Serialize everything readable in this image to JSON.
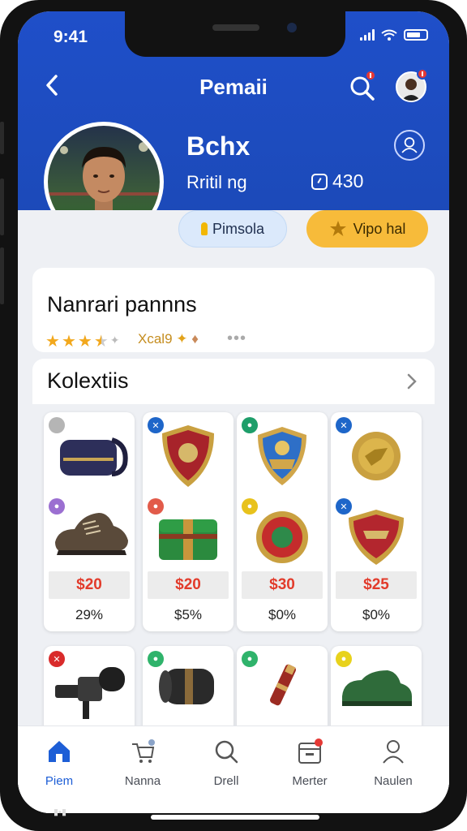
{
  "status_bar": {
    "time": "9:41"
  },
  "header": {
    "title": "Pemaii"
  },
  "profile": {
    "name": "Bchx",
    "subtitle": "Rritil ng",
    "score": "430"
  },
  "actions": {
    "primary_label": "Pimsola",
    "secondary_label": "Vipo hal"
  },
  "rating": {
    "title": "Nanrari pannns",
    "stars": 3.5,
    "meta": "Xcal9"
  },
  "collection": {
    "title": "Kolextiis",
    "items": [
      {
        "price": "$20",
        "percent": "29%",
        "badge_color": "#9e9e9e",
        "art": "bag",
        "badge2_color": "#9b6fd1",
        "art2": "shoe"
      },
      {
        "price": "$20",
        "percent": "$5%",
        "badge_color": "#1e66c9",
        "art": "shield-red",
        "badge2_color": "#e25b4a",
        "art2": "chest"
      },
      {
        "price": "$30",
        "percent": "$0%",
        "badge_color": "#1e9e6a",
        "art": "shield-blue",
        "badge2_color": "#e8c21c",
        "art2": "medal-round"
      },
      {
        "price": "$25",
        "percent": "$0%",
        "badge_color": "#1e66c9",
        "art": "medal-gold",
        "badge2_color": "#e25b4a",
        "art2": "shield-red2"
      }
    ],
    "row2": [
      {
        "badge_color": "#d92b2b",
        "art": "camera"
      },
      {
        "badge_color": "#2fb36b",
        "art": "barrel"
      },
      {
        "badge_color": "#2fb36b",
        "art": "bottle"
      },
      {
        "badge_color": "#e8d21c",
        "art": "shoe-green"
      }
    ]
  },
  "bottom_nav": [
    {
      "label": "Piem",
      "icon": "home-icon",
      "active": true
    },
    {
      "label": "Nanna",
      "icon": "cart-icon",
      "active": false
    },
    {
      "label": "Drell",
      "icon": "search-icon",
      "active": false
    },
    {
      "label": "Merter",
      "icon": "calendar-icon",
      "active": false,
      "badge": true
    },
    {
      "label": "Naulen",
      "icon": "person-icon",
      "active": false
    }
  ],
  "colors": {
    "header_blue": "#1f4fc9",
    "accent_yellow": "#f7bb3a",
    "price_red": "#e23b2b",
    "active_nav": "#1d5ed6"
  }
}
